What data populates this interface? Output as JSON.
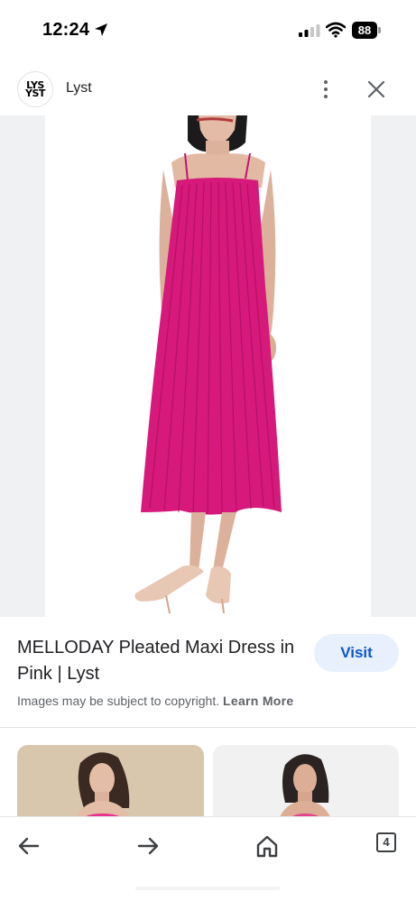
{
  "status_bar": {
    "time": "12:24",
    "battery": "88",
    "icons": [
      "location-arrow-icon",
      "signal-icon",
      "wifi-icon",
      "battery-icon"
    ]
  },
  "header": {
    "logo_lines": [
      "LYS",
      "YST"
    ],
    "site_name": "Lyst",
    "icons": [
      "more-vertical-icon",
      "close-icon"
    ]
  },
  "colors": {
    "dress": "#d6197a",
    "visit_bg": "#e8f0fe",
    "visit_text": "#0b57d0",
    "side_panel": "#f0f1f3"
  },
  "result": {
    "title": "MELLODAY Pleated Maxi Dress in Pink | Lyst",
    "visit_label": "Visit",
    "copyright_text": "Images may be subject to copyright.",
    "learn_more_label": "Learn More"
  },
  "toolbar": {
    "tab_count": "4",
    "icons": [
      "back-arrow-icon",
      "forward-arrow-icon",
      "home-icon",
      "tabs-icon"
    ]
  }
}
